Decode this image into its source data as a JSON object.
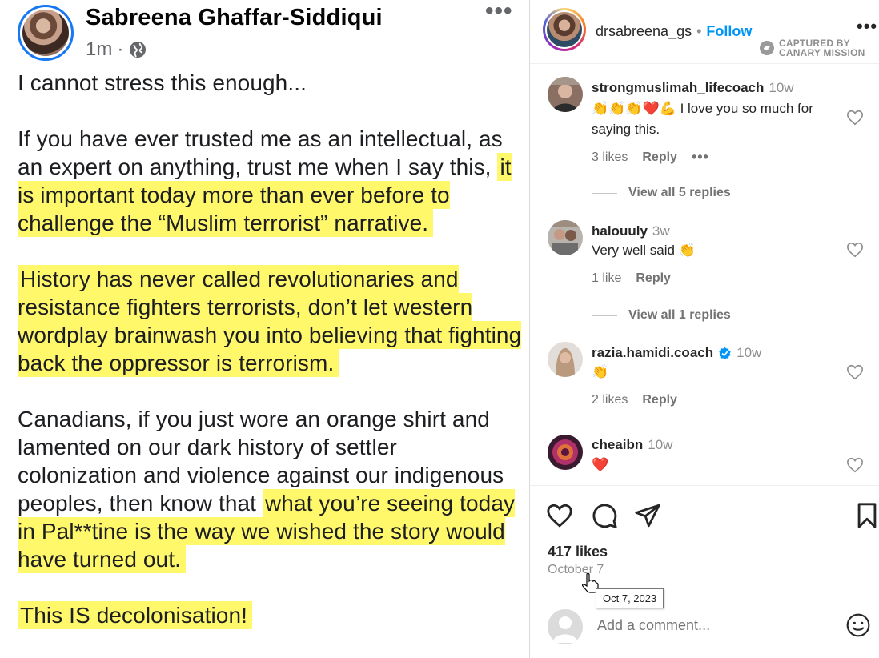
{
  "facebook_post": {
    "author": "Sabreena Ghaffar-Siddiqui",
    "time": "1m",
    "separator": "·",
    "more": "•••",
    "paragraphs": [
      {
        "plain": "I cannot stress this enough...",
        "highlight": ""
      },
      {
        "plain": "If you have ever trusted me as an intellectual, as an expert on anything, trust me when I say this, ",
        "highlight": "it is important today more than ever before to challenge the “Muslim terrorist” narrative."
      },
      {
        "plain": "",
        "highlight": "History has never called revolutionaries and resistance fighters terrorists, don’t let western wordplay brainwash you into believing that fighting back the oppressor is terrorism."
      },
      {
        "plain": "Canadians, if you just wore an orange shirt and lamented on our dark history of settler colonization and violence against our indigenous peoples, then know that ",
        "highlight": "what you’re seeing today in Pal**tine is the way we wished the story would have turned out."
      },
      {
        "plain": "",
        "highlight": "This IS decolonisation!"
      }
    ],
    "highlight_color": "#fff86b"
  },
  "instagram": {
    "username": "drsabreena_gs",
    "separator": "•",
    "follow_label": "Follow",
    "more": "•••",
    "captured_line1": "CAPTURED BY",
    "captured_line2": "CANARY MISSION",
    "comments": [
      {
        "user": "strongmuslimah_lifecoach",
        "time": "10w",
        "emojis": "👏👏👏❤️💪",
        "text": " I love you so much for saying this.",
        "likes": "3 likes",
        "reply": "Reply",
        "more": "•••",
        "replies": "View all 5 replies"
      },
      {
        "user": "halouuly",
        "time": "3w",
        "emojis": "",
        "text": "Very well said 👏",
        "likes": "1 like",
        "reply": "Reply",
        "more": "",
        "replies": "View all 1 replies"
      },
      {
        "user": "razia.hamidi.coach",
        "time": "10w",
        "emojis": "👏",
        "text": "",
        "likes": "2 likes",
        "reply": "Reply",
        "more": "",
        "replies": ""
      },
      {
        "user": "cheaibn",
        "time": "10w",
        "emojis": "❤️",
        "text": "",
        "likes": "",
        "reply": "",
        "more": "",
        "replies": ""
      }
    ],
    "like_count": "417 likes",
    "date": "October 7",
    "date_tooltip": "Oct 7, 2023",
    "add_comment_placeholder": "Add a comment...",
    "icons": [
      "heart-icon",
      "comment-icon",
      "share-icon",
      "bookmark-icon",
      "emoji-icon"
    ],
    "link_color": "#0095f6"
  }
}
